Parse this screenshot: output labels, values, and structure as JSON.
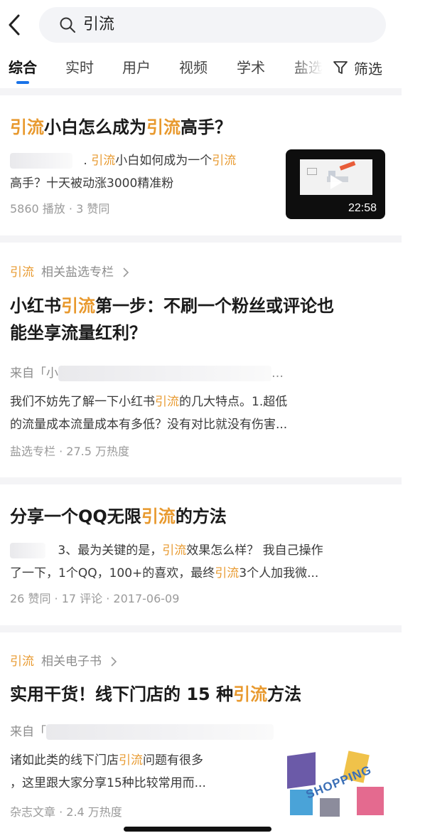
{
  "search": {
    "query": "引流"
  },
  "tabs": [
    {
      "label": "综合"
    },
    {
      "label": "实时"
    },
    {
      "label": "用户"
    },
    {
      "label": "视频"
    },
    {
      "label": "学术"
    },
    {
      "label": "盐选"
    }
  ],
  "filter_label": "筛选",
  "results": [
    {
      "title_parts": [
        "引流",
        "小白怎么成为",
        "引流",
        "高手？"
      ],
      "snippet_line1": [
        "引流",
        "小白如何成为一个",
        "引流"
      ],
      "snippet_line2": "高手？十天被动涨3000精准粉",
      "meta": "5860 播放 · 3 赞同",
      "video_duration": "22:58"
    },
    {
      "tag_keyword": "引流",
      "tag_label": "相关盐选专栏",
      "title_line1": [
        "小红书",
        "引流",
        "第一步：不刷一个粉丝或评论也"
      ],
      "title_line2": "能坐享流量红利？",
      "source_prefix": "来自「小",
      "source_suffix": "…",
      "snippet_line1": [
        "我们不妨先了解一下小红书",
        "引流",
        "的几大特点。1.超低"
      ],
      "snippet_line2": "的流量成本流量成本有多低？没有对比就没有伤害...",
      "meta": "盐选专栏 · 27.5 万热度"
    },
    {
      "title_parts": [
        "分享一个QQ无限",
        "引流",
        "的方法"
      ],
      "snippet_line1": [
        "3、最为关键的是，",
        "引流",
        "效果怎么样？ 我自己操作"
      ],
      "snippet_line2": [
        "了一下，1个QQ，100+的喜欢，最终",
        "引流",
        "3个人加我微..."
      ],
      "meta": "26 赞同 · 17 评论 · 2017-06-09"
    },
    {
      "tag_keyword": "引流",
      "tag_label": "相关电子书",
      "title_parts": [
        "实用干货！线下门店的 15 种",
        "引流",
        "方法"
      ],
      "source_prefix": "来自「",
      "snippet_line1": [
        "诸如此类的线下门店",
        "引流",
        "问题有很多"
      ],
      "snippet_line2": "，这里跟大家分享15种比较常用而...",
      "meta": "杂志文章 · 2.4 万热度",
      "book_cover_text": "SHOPPING"
    }
  ],
  "colors": {
    "highlight": "#e8992e",
    "accent": "#1a73e8",
    "separator": "#f4f4f6"
  }
}
